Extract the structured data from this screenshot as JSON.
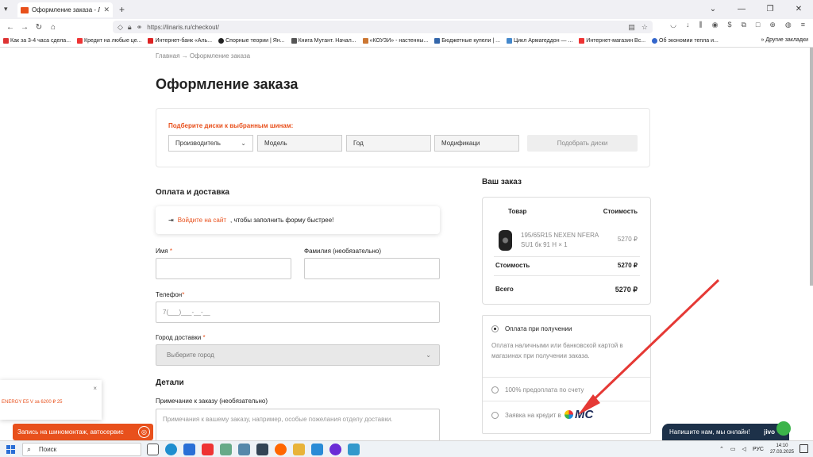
{
  "browser": {
    "tab_title": "Оформление заказа - Линарис",
    "url": "https://linaris.ru/checkout/",
    "bookmarks": [
      "Как за 3-4 часа сдела...",
      "Кредит на любые це...",
      "Интернет-банк «Аль...",
      "Спорные теории | Ян...",
      "Книга Мутант. Начал...",
      "«КОУЗИ» - настенны...",
      "Бюджетные купели | ...",
      "Цикл Армагеддон — ...",
      "Интернет-магазин Вс...",
      "Об экономии тепла и..."
    ],
    "other_bookmarks": "Другие закладки"
  },
  "breadcrumb": {
    "home": "Главная",
    "sep": "→",
    "current": "Оформление заказа"
  },
  "page_title": "Оформление заказа",
  "filter": {
    "title": "Подберите диски к выбранным шинам:",
    "manufacturer": "Производитель",
    "model": "Модель",
    "year": "Год",
    "modification": "Модификаци",
    "button": "Подобрать диски"
  },
  "delivery": {
    "heading": "Оплата и доставка",
    "login_link": "Войдите на сайт",
    "login_rest": ", чтобы заполнить форму быстрее!",
    "name_label": "Имя",
    "surname_label": "Фамилия (необязательно)",
    "phone_label": "Телефон",
    "phone_placeholder": "7(___)___-__-__",
    "city_label": "Город доставки",
    "city_placeholder": "Выберите город",
    "required_mark": "*"
  },
  "details": {
    "heading": "Детали",
    "note_label": "Примечание к заказу (необязательно)",
    "note_placeholder": "Примечания к вашему заказу, например, особые пожелания отделу доставки."
  },
  "order": {
    "heading": "Ваш заказ",
    "col_product": "Товар",
    "col_cost": "Стоимость",
    "item_name_line1": "195/65R15 NEXEN NFERA",
    "item_name_line2": "SU1 бк 91 H  × 1",
    "item_price": "5270 ₽",
    "subtotal_label": "Стоимость",
    "subtotal_value": "5270 ₽",
    "total_label": "Всего",
    "total_value": "5270 ₽"
  },
  "payment": {
    "option1": "Оплата при получении",
    "option1_desc_line1": "Оплата наличными или банковской картой в",
    "option1_desc_line2": "магазинах при получении заказа.",
    "option2": "100% предоплата по счету",
    "option3": "Заявка на кредит в",
    "mc_logo": "MC"
  },
  "promo": {
    "text": "ENERGY E5 V  за 6200  ₽ 25",
    "banner": "Запись на шиномонтаж, автосервис",
    "close": "×"
  },
  "chat": {
    "text": "Напишите нам, мы онлайн!",
    "brand": "jivo"
  },
  "taskbar": {
    "search": "Поиск",
    "lang": "РУС",
    "time": "14:10",
    "date": "27.03.2025"
  },
  "colors": {
    "accent": "#e8501c",
    "arrow": "#e53935"
  }
}
